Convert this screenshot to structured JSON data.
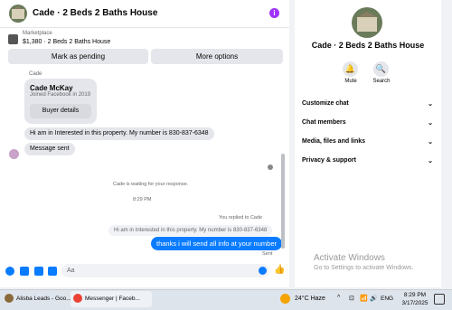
{
  "header": {
    "title": "Cade · 2 Beds 2 Baths House",
    "info_icon": "i"
  },
  "marketplace": {
    "label": "Marketplace",
    "listing": "$1,380 · 2 Beds 2 Baths House",
    "buttons": {
      "mark_pending": "Mark as pending",
      "more_options": "More options"
    }
  },
  "messages": {
    "sender_name": "Cade",
    "card": {
      "name": "Cade McKay",
      "joined": "Joined Facebook in 2019",
      "button": "Buyer details"
    },
    "inquiry": "Hi am in Interested in this property. My number is 830-837-6348",
    "message_sent": "Message sent",
    "system_waiting": "Cade is waiting for your response.",
    "timestamp": "8:29 PM",
    "replied_label": "You replied to Cade",
    "quoted": "Hi am in Interested in this property. My number is 830-837-6348",
    "reply": "thanks i will send all info at your number",
    "status": "Sent"
  },
  "composer": {
    "placeholder": "Aa",
    "like_icon": "👍"
  },
  "right_panel": {
    "title": "Cade · 2 Beds 2 Baths House",
    "actions": [
      {
        "icon": "🔔",
        "label": "Mute"
      },
      {
        "icon": "🔍",
        "label": "Search"
      }
    ],
    "rows": [
      "Customize chat",
      "Chat members",
      "Media, files and links",
      "Privacy & support"
    ]
  },
  "watermark": {
    "title": "Activate Windows",
    "sub": "Go to Settings to activate Windows."
  },
  "taskbar": {
    "tasks": [
      "Alisba Leads - Goo...",
      "Messenger | Faceb..."
    ],
    "weather": "24°C  Haze",
    "tray_icons": [
      "^",
      "⊡",
      "📶",
      "🔊"
    ],
    "lang": "ENG",
    "time": "8:29 PM",
    "date": "3/17/2025"
  },
  "colors": {
    "accent": "#0a7cff",
    "info": "#a033ff"
  }
}
